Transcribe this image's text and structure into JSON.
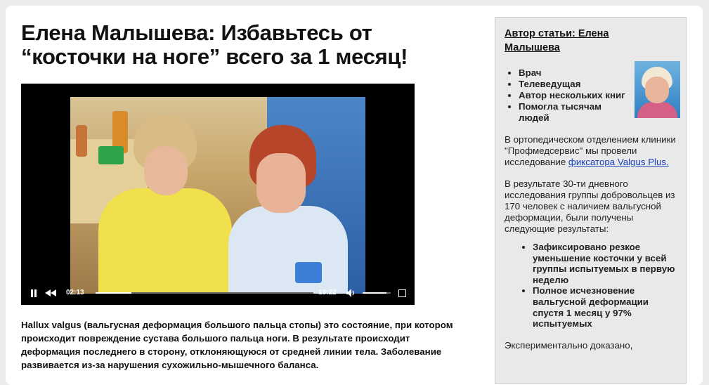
{
  "article": {
    "title_line1": "Елена Малышева: Избавьтесь от",
    "title_line2": "“косточки на ноге” всего за 1 месяц!",
    "description": "Hallux valgus (вальгусная деформация большого пальца стопы) это состояние, при котором происходит повреждение сустава большого пальца ноги. В результате происходит деформация последнего в сторону, отклоняющуюся от средней линии тела. Заболевание развивается из-за нарушения сухожильно-мышечного баланса."
  },
  "video": {
    "current_time": "02:13",
    "duration": "13:22",
    "progress_fraction": 0.166,
    "volume_fraction": 0.85,
    "icons": [
      "pause-icon",
      "rewind-icon",
      "volume-icon",
      "fullscreen-icon"
    ]
  },
  "sidebar": {
    "title": "Автор статьи: Елена Малышева",
    "facts": [
      "Врач",
      "Телеведущая",
      "Автор нескольких книг",
      "Помогла тысячам людей"
    ],
    "para1_text": "В ортопедическом отделением клиники \"Профмедсервис\" мы провели исследование ",
    "para1_link": "фиксатора Valgus Plus.",
    "para2": "В результате 30-ти дневного исследования группы добровольцев из 170 человек с наличием вальгусной деформации, были получены следующие результаты:",
    "results": [
      "Зафиксировано резкое уменьшение косточки у всей группы испытуемых в первую неделю",
      "Полное исчезновение вальгусной деформации спустя 1 месяц у 97% испытуемых"
    ],
    "para3": "Экспериментально доказано,"
  },
  "colors": {
    "link": "#1a3fbf",
    "sidebar_bg": "#e9e9e9",
    "page_bg": "#ececec"
  }
}
